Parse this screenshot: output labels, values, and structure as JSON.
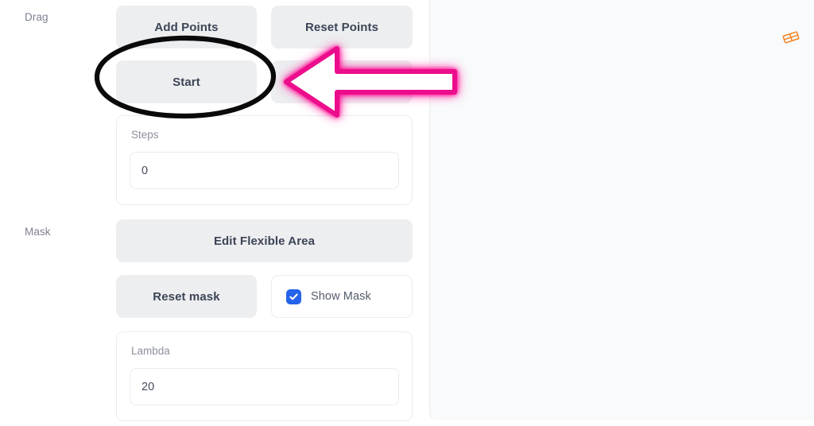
{
  "groups": [
    {
      "key": "drag",
      "label": "Drag"
    },
    {
      "key": "mask",
      "label": "Mask"
    }
  ],
  "drag": {
    "label": "Drag",
    "buttons": [
      {
        "name": "add-points-button",
        "label": "Add Points"
      },
      {
        "name": "reset-points-button",
        "label": "Reset Points"
      },
      {
        "name": "start-button",
        "label": "Start"
      },
      {
        "name": "stop-button",
        "label": ""
      }
    ],
    "steps_field": {
      "label": "Steps",
      "value": "0"
    }
  },
  "mask": {
    "label": "Mask",
    "edit_flexible_area_label": "Edit Flexible Area",
    "reset_mask_label": "Reset mask",
    "show_mask": {
      "label": "Show Mask",
      "checked": true,
      "accent_color": "#2563eb"
    },
    "lambda_field": {
      "label": "Lambda",
      "value": "20"
    }
  },
  "preview": {
    "brand_icon": "draggan-logo-icon",
    "brand_color": "#f58220",
    "background_color": "#f8fafb"
  },
  "annotations": {
    "ellipse": {
      "name": "highlight-ellipse",
      "color": "#000000",
      "target": "Start"
    },
    "arrow": {
      "name": "pointer-arrow",
      "color": "#ec0f8c",
      "fill": "#ffffff",
      "direction": "left",
      "target": "Start"
    }
  },
  "theme": {
    "button_bg": "#eceef0",
    "button_text": "#3d4455",
    "panel_bg": "#f8fafb",
    "border": "#ececf0",
    "label_text": "#7d8290"
  }
}
